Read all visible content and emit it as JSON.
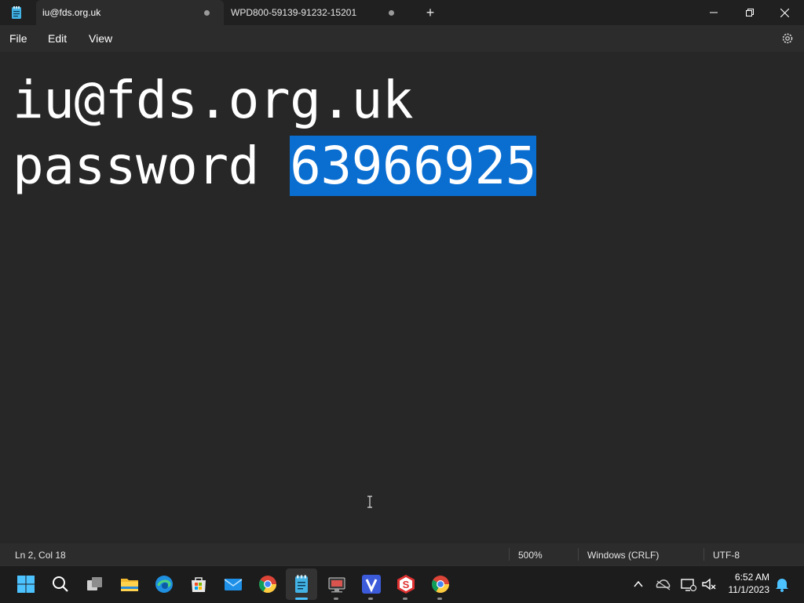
{
  "window": {
    "tabs": [
      {
        "label": "iu@fds.org.uk",
        "active": true
      },
      {
        "label": "WPD800-59139-91232-15201",
        "active": false
      }
    ]
  },
  "menu": {
    "items": [
      "File",
      "Edit",
      "View"
    ]
  },
  "editor": {
    "line1": "iu@fds.org.uk",
    "line2_prefix": "password ",
    "line2_selected": "63966925"
  },
  "status": {
    "position": "Ln 2, Col 18",
    "zoom": "500%",
    "line_ending": "Windows (CRLF)",
    "encoding": "UTF-8"
  },
  "taskbar": {
    "icons": [
      "start-icon",
      "search-icon",
      "task-view-icon",
      "file-explorer-icon",
      "edge-icon",
      "store-icon",
      "mail-icon",
      "chrome-icon",
      "notepad-icon",
      "app-icon",
      "v-app-icon",
      "s-app-icon",
      "chrome-icon"
    ],
    "clock": {
      "time": "6:52 AM",
      "date": "11/1/2023"
    }
  },
  "colors": {
    "selection": "#0a6ed1",
    "background": "#272727",
    "accent": "#4cc2ff"
  }
}
